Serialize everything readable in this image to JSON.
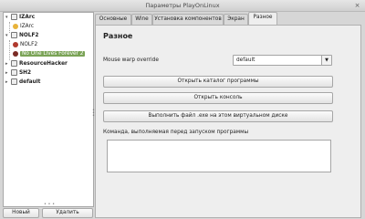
{
  "window": {
    "title": "Параметры PlayOnLinux",
    "close_glyph": "×"
  },
  "tree": {
    "items": [
      {
        "label": "IZArc",
        "bold": true,
        "expander": "▾"
      },
      {
        "label": "IZArc",
        "bold": false
      },
      {
        "label": "NOLF2",
        "bold": true,
        "expander": "▾"
      },
      {
        "label": "NOLF2",
        "bold": false
      },
      {
        "label": "No One Lives Forever 2",
        "bold": false,
        "selected": true
      },
      {
        "label": "ResourceHacker",
        "bold": true,
        "expander": "▸"
      },
      {
        "label": "SH2",
        "bold": true,
        "expander": "▸"
      },
      {
        "label": "default",
        "bold": true,
        "expander": "▸"
      }
    ]
  },
  "left_buttons": {
    "new_label": "Новый",
    "delete_label": "Удалить"
  },
  "tabs": [
    {
      "label": "Основные"
    },
    {
      "label": "Wine"
    },
    {
      "label": "Установка компонентов"
    },
    {
      "label": "Экран"
    },
    {
      "label": "Разное",
      "active": true
    }
  ],
  "misc": {
    "title": "Разное",
    "mouse_warp_label": "Mouse warp override",
    "mouse_warp_value": "default",
    "buttons": {
      "open_dir": "Открыть каталог программы",
      "open_console": "Открыть консоль",
      "run_exe": "Выполнить файл .exe на этом виртуальном диске"
    },
    "command_label": "Команда, выполняемая перед запуском программы",
    "command_value": ""
  },
  "colors": {
    "selection": "#7aa356"
  }
}
